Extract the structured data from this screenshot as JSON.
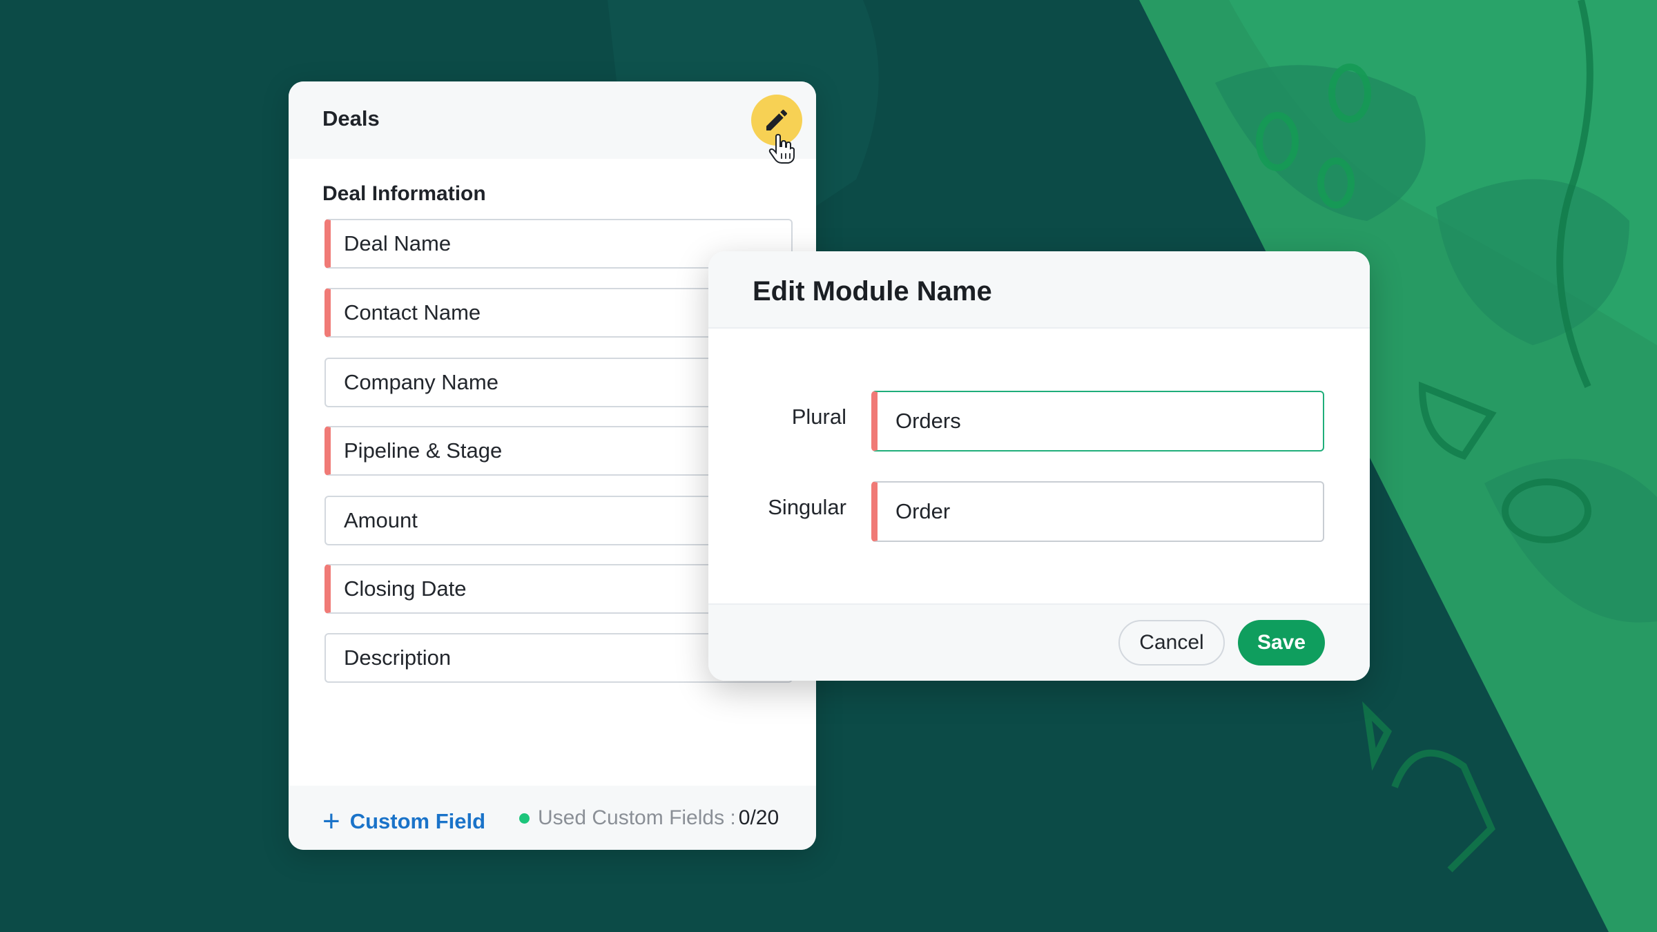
{
  "deals_card": {
    "title": "Deals",
    "edit_icon": "pencil-icon",
    "cursor_icon": "hand-pointer-icon",
    "section_title": "Deal Information",
    "fields": [
      {
        "label": "Deal Name",
        "mandatory": true
      },
      {
        "label": "Contact Name",
        "mandatory": true
      },
      {
        "label": "Company Name",
        "mandatory": false
      },
      {
        "label": "Pipeline & Stage",
        "mandatory": true
      },
      {
        "label": "Amount",
        "mandatory": false
      },
      {
        "label": "Closing Date",
        "mandatory": true
      },
      {
        "label": "Description",
        "mandatory": false
      }
    ],
    "footer": {
      "add_label": "Custom Field",
      "add_icon": "plus-icon",
      "used_label": "Used Custom Fields :",
      "used_value": "0/20"
    }
  },
  "modal": {
    "title": "Edit Module Name",
    "plural_label": "Plural",
    "plural_value": "Orders",
    "singular_label": "Singular",
    "singular_value": "Order",
    "cancel_label": "Cancel",
    "save_label": "Save"
  },
  "colors": {
    "background": "#0c4b47",
    "accent_green": "#0f9e5e",
    "mandatory_marker": "#f07a76",
    "link_blue": "#1a73c9",
    "edit_button": "#f7d154"
  }
}
